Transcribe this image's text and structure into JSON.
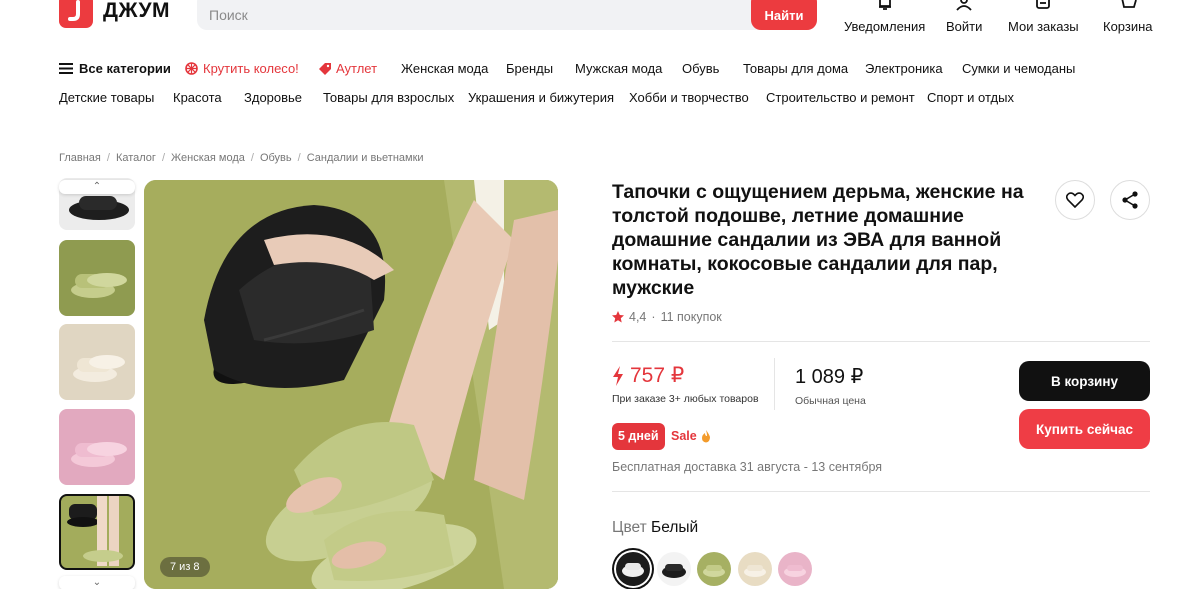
{
  "header": {
    "logo_text": "ДЖУМ",
    "search_placeholder": "Поиск",
    "search_button": "Найти",
    "actions": [
      {
        "label": "Уведомления",
        "icon": "bell-icon"
      },
      {
        "label": "Войти",
        "icon": "user-icon"
      },
      {
        "label": "Мои заказы",
        "icon": "orders-icon"
      },
      {
        "label": "Корзина",
        "icon": "cart-icon"
      }
    ]
  },
  "categories": {
    "row1": [
      "Все категории",
      "Крутить колесо!",
      "Аутлет",
      "Женская мода",
      "Бренды",
      "Мужская мода",
      "Обувь",
      "Товары для дома",
      "Электроника",
      "Сумки и чемоданы"
    ],
    "row2": [
      "Детские товары",
      "Красота",
      "Здоровье",
      "Товары для взрослых",
      "Украшения и бижутерия",
      "Хобби и творчество",
      "Строительство и ремонт",
      "Спорт и отдых"
    ]
  },
  "breadcrumb": [
    "Главная",
    "Каталог",
    "Женская мода",
    "Обувь",
    "Сандалии и вьетнамки"
  ],
  "gallery": {
    "counter": "7 из 8",
    "thumb_colors": [
      "#222222",
      "#a9b36a",
      "#e9e1cf",
      "#e6b3c6",
      "#222222"
    ]
  },
  "product": {
    "title": "Тапочки с ощущением дерьма, женские на толстой подошве, летние домашние домашние сандалии из ЭВА для ванной комнаты, кокосовые сандалии для пар, мужские",
    "rating": "4,4",
    "reviews": "11 покупок",
    "sale_price": "757 ₽",
    "sale_note": "При заказе 3+ любых товаров",
    "regular_price": "1 089 ₽",
    "regular_note": "Обычная цена",
    "cart_button": "В корзину",
    "buy_button": "Купить сейчас",
    "days_badge": "5 дней",
    "sale_label": "Sale",
    "delivery": "Бесплатная доставка 31 августа - 13 сентября",
    "color_key": "Цвет",
    "color_value": "Белый",
    "swatches": [
      {
        "name": "white",
        "color": "#f2f2f2"
      },
      {
        "name": "black",
        "color": "#1c1c1c"
      },
      {
        "name": "green",
        "color": "#a6b063"
      },
      {
        "name": "beige",
        "color": "#e8dcc3"
      },
      {
        "name": "pink",
        "color": "#e9b4c8"
      }
    ]
  },
  "colors": {
    "brand_red": "#ec3b3f",
    "price_red": "#e4363c",
    "dark_button": "#111111"
  }
}
